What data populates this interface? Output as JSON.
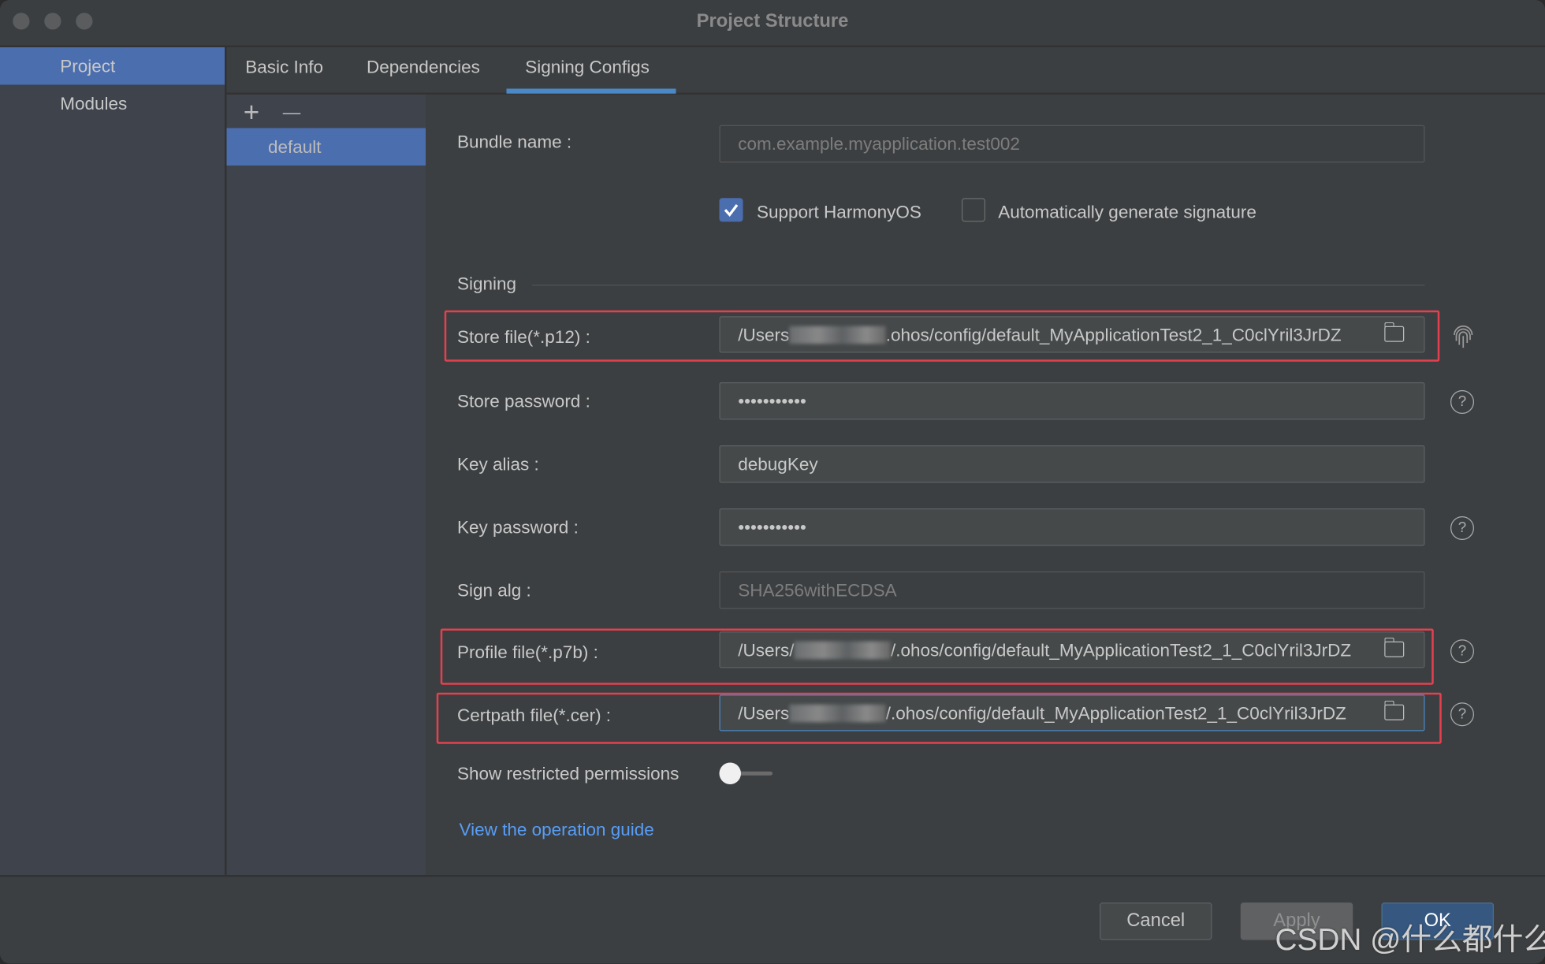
{
  "window": {
    "title": "Project Structure"
  },
  "sidebar": {
    "items": [
      {
        "label": "Project",
        "selected": true
      },
      {
        "label": "Modules",
        "selected": false
      }
    ]
  },
  "tabs": [
    {
      "label": "Basic Info"
    },
    {
      "label": "Dependencies"
    },
    {
      "label": "Signing Configs",
      "active": true
    }
  ],
  "configs": {
    "add": "+",
    "remove": "—",
    "items": [
      "default"
    ]
  },
  "form": {
    "bundle_name": {
      "label": "Bundle name :",
      "placeholder": "com.example.myapplication.test002"
    },
    "support_harmonyos": {
      "label": "Support HarmonyOS",
      "checked": true
    },
    "auto_sign": {
      "label": "Automatically generate signature",
      "checked": false
    },
    "signing_section": "Signing",
    "store_file": {
      "label": "Store file(*.p12) :",
      "prefix": "/Users",
      "suffix": ".ohos/config/default_MyApplicationTest2_1_C0clYril3JrDZ"
    },
    "store_password": {
      "label": "Store password :",
      "value": "•••••••••••"
    },
    "key_alias": {
      "label": "Key alias :",
      "value": "debugKey"
    },
    "key_password": {
      "label": "Key password :",
      "value": "•••••••••••"
    },
    "sign_alg": {
      "label": "Sign alg :",
      "value": "SHA256withECDSA"
    },
    "profile_file": {
      "label": "Profile file(*.p7b) :",
      "prefix": "/Users/",
      "suffix": "/.ohos/config/default_MyApplicationTest2_1_C0clYril3JrDZ"
    },
    "certpath_file": {
      "label": "Certpath file(*.cer) :",
      "prefix": "/Users",
      "suffix": "/.ohos/config/default_MyApplicationTest2_1_C0clYril3JrDZ"
    },
    "restricted": {
      "label": "Show restricted permissions",
      "on": false
    },
    "guide_link": "View the operation guide"
  },
  "help_glyph": "?",
  "buttons": {
    "cancel": "Cancel",
    "apply": "Apply",
    "ok": "OK"
  },
  "watermark": "CSDN @什么都什么",
  "colors": {
    "accent": "#4b6eaf",
    "highlight_border": "#e5404f",
    "link": "#589df6"
  }
}
